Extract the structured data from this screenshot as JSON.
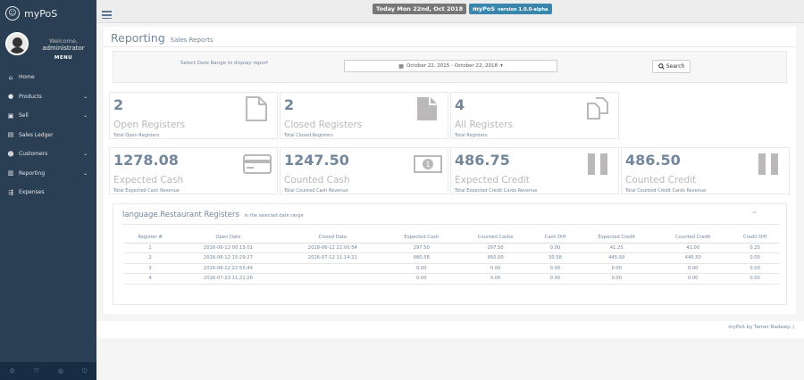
{
  "sidebar": {
    "brand": "myPoS",
    "welcome": "Welcome,",
    "username": "administrator",
    "menu_title": "MENU",
    "items": [
      {
        "label": "Home",
        "icon": "home-icon",
        "chevron": false
      },
      {
        "label": "Products",
        "icon": "products-icon",
        "chevron": true
      },
      {
        "label": "Sell",
        "icon": "sell-icon",
        "chevron": true
      },
      {
        "label": "Sales Ledger",
        "icon": "ledger-icon",
        "chevron": false
      },
      {
        "label": "Customers",
        "icon": "customers-icon",
        "chevron": true
      },
      {
        "label": "Reporting",
        "icon": "reporting-icon",
        "chevron": true
      },
      {
        "label": "Expenses",
        "icon": "expenses-icon",
        "chevron": false
      }
    ]
  },
  "topbar": {
    "date_badge": "Today Mon 22nd, Oct 2018",
    "app_name": "myPoS",
    "version": "version 1.0.0-alpha"
  },
  "page": {
    "title": "Reporting",
    "subtitle": "Sales Reports"
  },
  "filter": {
    "label": "Select Date Range to display report",
    "date_range": "October 22, 2015 - October 22, 2018",
    "search_label": "Search"
  },
  "tiles_row1": [
    {
      "count": "2",
      "title": "Open Registers",
      "sub": "Total Open Registers",
      "icon": "file-outline-icon"
    },
    {
      "count": "2",
      "title": "Closed Registers",
      "sub": "Total Closed Registers",
      "icon": "file-solid-icon"
    },
    {
      "count": "4",
      "title": "All Registers",
      "sub": "Total Registers",
      "icon": "files-icon"
    }
  ],
  "tiles_row2": [
    {
      "count": "1278.08",
      "title": "Expected Cash",
      "sub": "Total Expected Cash Revenue",
      "icon": "credit-card-icon"
    },
    {
      "count": "1247.50",
      "title": "Counted Cash",
      "sub": "Total Counted Cash Revenue",
      "icon": "money-icon"
    },
    {
      "count": "486.75",
      "title": "Expected Credit",
      "sub": "Total Expected Credit Cards Revenue",
      "icon": "pause-icon"
    },
    {
      "count": "486.50",
      "title": "Counted Credit",
      "sub": "Total Counted Credit Cards Revenue",
      "icon": "pause-icon"
    }
  ],
  "registers": {
    "title": "language.Restaurant Registers",
    "subtitle": "in the selected date range",
    "columns": [
      "Register #",
      "Open Date",
      "Closed Date",
      "Expected Cash",
      "Counted Cashe",
      "Cash Diff",
      "Expected Credit",
      "Counted Credit",
      "Credit Diff"
    ],
    "rows": [
      [
        "1",
        "2016-06-12 00:15:01",
        "2018-06-12 22:00:54",
        "297.50",
        "297.50",
        "0.00",
        "41.25",
        "41.00",
        "0.25"
      ],
      [
        "2",
        "2016-06-12 15:29:27",
        "2016-07-12 11:14:21",
        "980.58",
        "950.00",
        "30.58",
        "445.50",
        "445.50",
        "0.00"
      ],
      [
        "3",
        "2016-06-12 22:55:44",
        "",
        "0.00",
        "0.00",
        "0.00",
        "0.00",
        "0.00",
        "0.00"
      ],
      [
        "4",
        "2016-07-23 11:21:26",
        "",
        "0.00",
        "0.00",
        "0.00",
        "0.00",
        "0.00",
        "0.00"
      ]
    ]
  },
  "footer": {
    "text": "myPoS by Tamer Badawy. |"
  }
}
